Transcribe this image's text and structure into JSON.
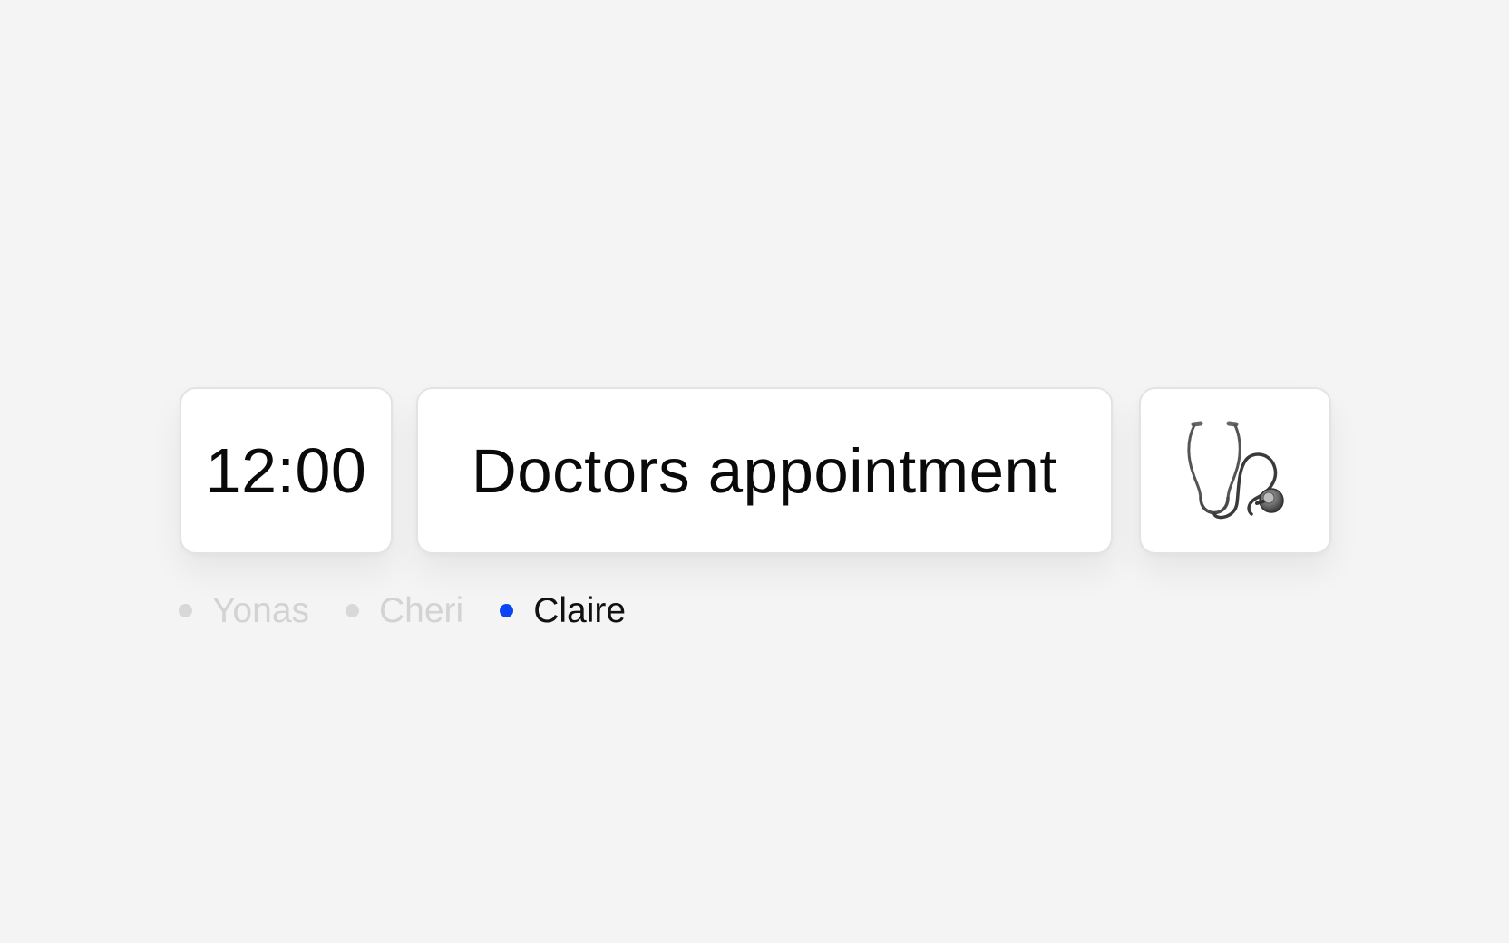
{
  "event": {
    "time": "12:00",
    "title": "Doctors appointment",
    "icon": "stethoscope-icon"
  },
  "assignees": [
    {
      "name": "Yonas",
      "selected": false
    },
    {
      "name": "Cheri",
      "selected": false
    },
    {
      "name": "Claire",
      "selected": true
    }
  ],
  "colors": {
    "background": "#f4f4f4",
    "card": "#ffffff",
    "accent": "#0a44f5",
    "inactive_text": "#d3d3d3",
    "inactive_dot": "#d8d8d8",
    "text": "#0a0a0a"
  }
}
